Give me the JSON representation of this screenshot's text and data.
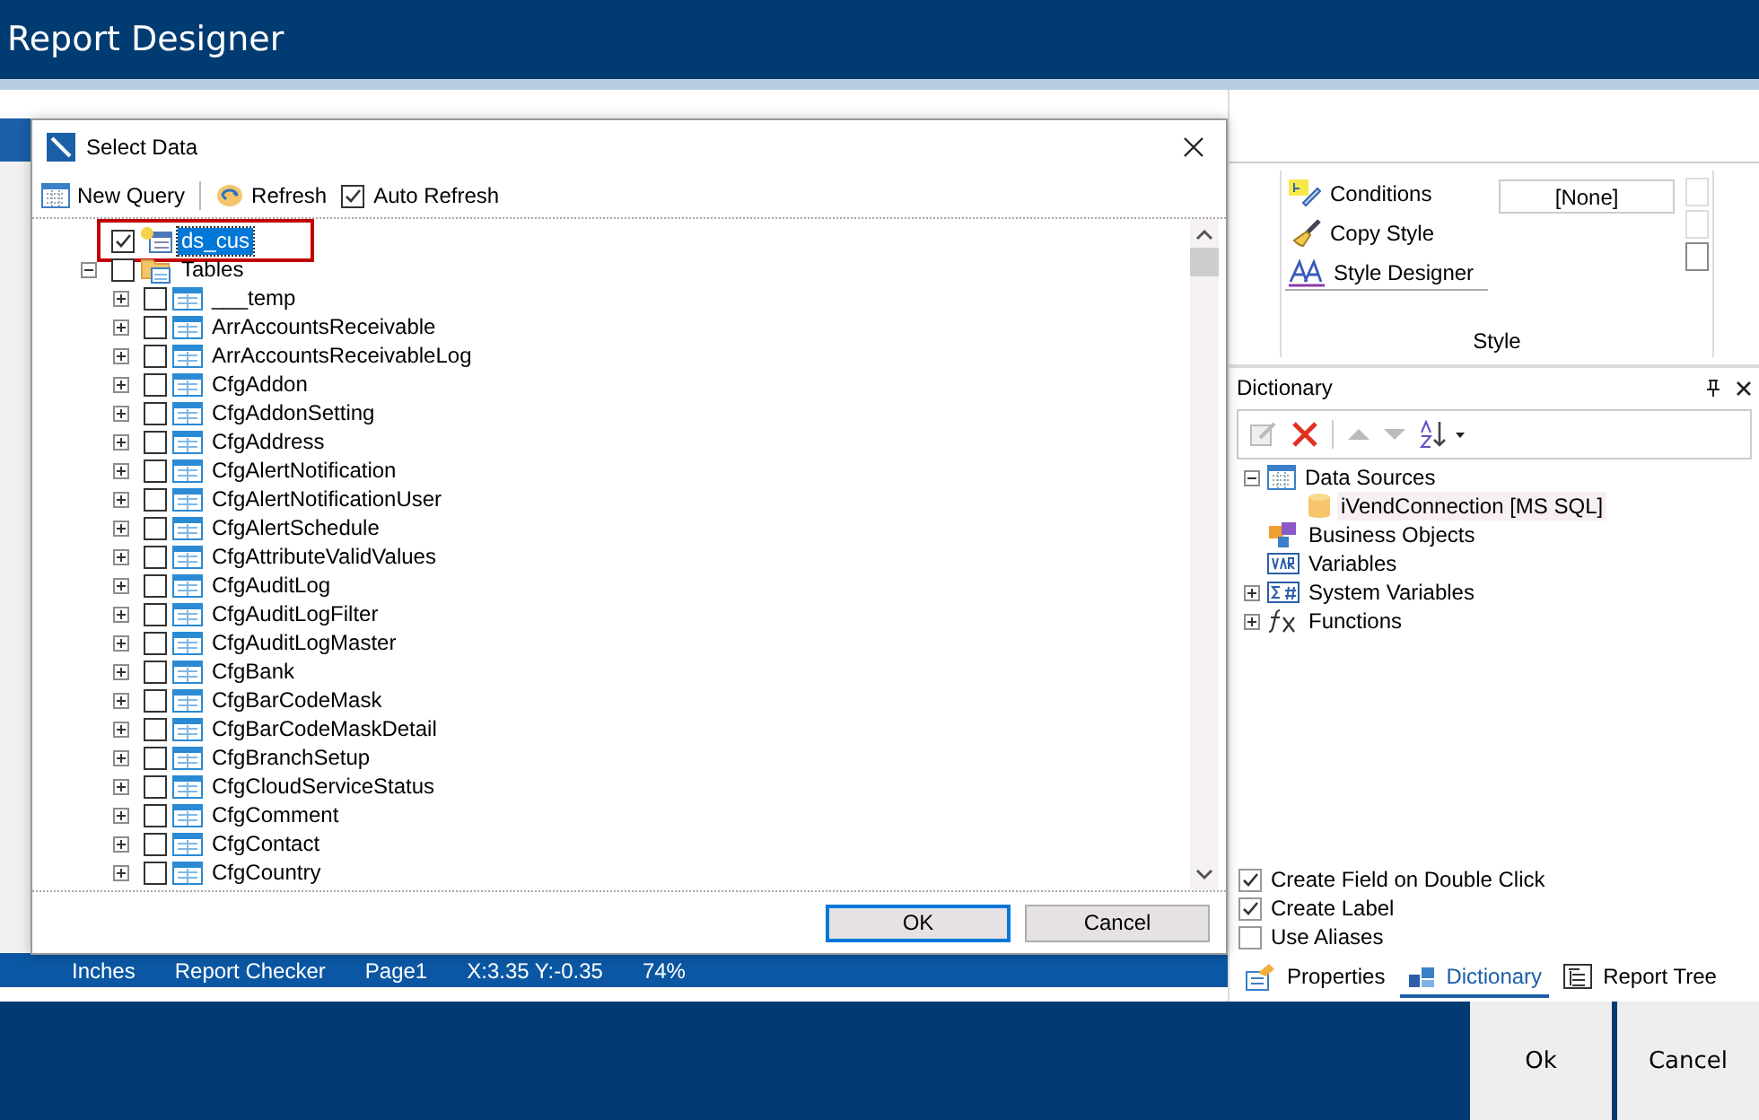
{
  "app": {
    "title": "Report Designer"
  },
  "status_bar": {
    "items": [
      "Inches",
      "Report Checker",
      "Page1",
      "X:3.35 Y:-0.35",
      "74%"
    ]
  },
  "dialog": {
    "title": "Select Data",
    "toolbar": {
      "new_query": "New Query",
      "refresh": "Refresh",
      "auto_refresh": {
        "label": "Auto Refresh",
        "checked": true
      }
    },
    "tree": [
      {
        "label": "ds_cus",
        "kind": "query",
        "checked": true,
        "selected": true,
        "highlighted": true
      },
      {
        "label": "Tables",
        "kind": "folder",
        "checked": false,
        "selected": false,
        "expanded": true,
        "children": [
          {
            "label": "___temp",
            "kind": "table",
            "checked": false,
            "selected": false,
            "expanded": false
          },
          {
            "label": "ArrAccountsReceivable",
            "kind": "table",
            "checked": false,
            "selected": false,
            "expanded": false
          },
          {
            "label": "ArrAccountsReceivableLog",
            "kind": "table",
            "checked": false,
            "selected": false,
            "expanded": false
          },
          {
            "label": "CfgAddon",
            "kind": "table",
            "checked": false,
            "selected": false,
            "expanded": false
          },
          {
            "label": "CfgAddonSetting",
            "kind": "table",
            "checked": false,
            "selected": false,
            "expanded": false
          },
          {
            "label": "CfgAddress",
            "kind": "table",
            "checked": false,
            "selected": false,
            "expanded": false
          },
          {
            "label": "CfgAlertNotification",
            "kind": "table",
            "checked": false,
            "selected": false,
            "expanded": false
          },
          {
            "label": "CfgAlertNotificationUser",
            "kind": "table",
            "checked": false,
            "selected": false,
            "expanded": false
          },
          {
            "label": "CfgAlertSchedule",
            "kind": "table",
            "checked": false,
            "selected": false,
            "expanded": false
          },
          {
            "label": "CfgAttributeValidValues",
            "kind": "table",
            "checked": false,
            "selected": false,
            "expanded": false
          },
          {
            "label": "CfgAuditLog",
            "kind": "table",
            "checked": false,
            "selected": false,
            "expanded": false
          },
          {
            "label": "CfgAuditLogFilter",
            "kind": "table",
            "checked": false,
            "selected": false,
            "expanded": false
          },
          {
            "label": "CfgAuditLogMaster",
            "kind": "table",
            "checked": false,
            "selected": false,
            "expanded": false
          },
          {
            "label": "CfgBank",
            "kind": "table",
            "checked": false,
            "selected": false,
            "expanded": false
          },
          {
            "label": "CfgBarCodeMask",
            "kind": "table",
            "checked": false,
            "selected": false,
            "expanded": false
          },
          {
            "label": "CfgBarCodeMaskDetail",
            "kind": "table",
            "checked": false,
            "selected": false,
            "expanded": false
          },
          {
            "label": "CfgBranchSetup",
            "kind": "table",
            "checked": false,
            "selected": false,
            "expanded": false
          },
          {
            "label": "CfgCloudServiceStatus",
            "kind": "table",
            "checked": false,
            "selected": false,
            "expanded": false
          },
          {
            "label": "CfgComment",
            "kind": "table",
            "checked": false,
            "selected": false,
            "expanded": false
          },
          {
            "label": "CfgContact",
            "kind": "table",
            "checked": false,
            "selected": false,
            "expanded": false
          },
          {
            "label": "CfgCountry",
            "kind": "table",
            "checked": false,
            "selected": false,
            "expanded": false
          }
        ]
      }
    ],
    "buttons": [
      {
        "label": "OK",
        "default": true
      },
      {
        "label": "Cancel",
        "default": false
      }
    ]
  },
  "ribbon": {
    "style_items": [
      {
        "label": "Conditions",
        "kind": "conditions"
      },
      {
        "label": "Copy Style",
        "kind": "copy"
      },
      {
        "label": "Style Designer",
        "kind": "designer"
      }
    ],
    "style_field": "[None]",
    "group_label": "Style"
  },
  "dictionary": {
    "title": "Dictionary",
    "tree": [
      {
        "label": "Data Sources",
        "kind": "datasources",
        "expanded": true,
        "selected": false,
        "children": [
          {
            "label": "iVendConnection [MS SQL]",
            "kind": "connection",
            "selected": true
          }
        ]
      },
      {
        "label": "Business Objects",
        "kind": "business",
        "selected": false
      },
      {
        "label": "Variables",
        "kind": "variables",
        "selected": false
      },
      {
        "label": "System Variables",
        "kind": "sysvars",
        "expanded": false,
        "selected": false
      },
      {
        "label": "Functions",
        "kind": "functions",
        "expanded": false,
        "selected": false
      }
    ],
    "options": [
      {
        "label": "Create Field on Double Click",
        "checked": true
      },
      {
        "label": "Create Label",
        "checked": true
      },
      {
        "label": "Use Aliases",
        "checked": false
      }
    ],
    "tabs": [
      {
        "label": "Properties",
        "kind": "properties",
        "selected": false
      },
      {
        "label": "Dictionary",
        "kind": "dictionary",
        "selected": true
      },
      {
        "label": "Report Tree",
        "kind": "tree",
        "selected": false
      }
    ]
  },
  "footer_buttons": [
    {
      "label": "Ok"
    },
    {
      "label": "Cancel"
    }
  ]
}
